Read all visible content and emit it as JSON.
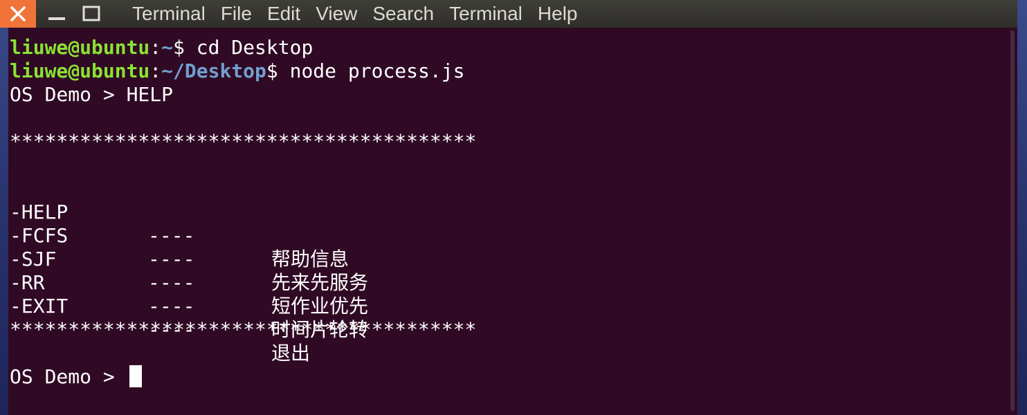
{
  "window": {
    "menu": [
      "Terminal",
      "File",
      "Edit",
      "View",
      "Search",
      "Terminal",
      "Help"
    ]
  },
  "terminal": {
    "line1": {
      "user": "liuwe@ubuntu",
      "colon": ":",
      "path": "~",
      "prompt": "$ ",
      "cmd": "cd Desktop"
    },
    "line2": {
      "user": "liuwe@ubuntu",
      "colon": ":",
      "path": "~/Desktop",
      "prompt": "$ ",
      "cmd": "node process.js"
    },
    "line3": "OS Demo > HELP",
    "stars": "****************************************",
    "help": [
      {
        "cmd": "-HELP",
        "sep": "----",
        "desc": "帮助信息"
      },
      {
        "cmd": "-FCFS",
        "sep": "----",
        "desc": "先来先服务"
      },
      {
        "cmd": "-SJF",
        "sep": "----",
        "desc": "短作业优先"
      },
      {
        "cmd": "-RR",
        "sep": "----",
        "desc": "时间片轮转"
      },
      {
        "cmd": "-EXIT",
        "sep": "----",
        "desc": "退出"
      }
    ],
    "prompt_final": "OS Demo > "
  },
  "colors": {
    "background": "#300a24",
    "user": "#8ae234",
    "path": "#729fcf",
    "close": "#f0743a"
  }
}
